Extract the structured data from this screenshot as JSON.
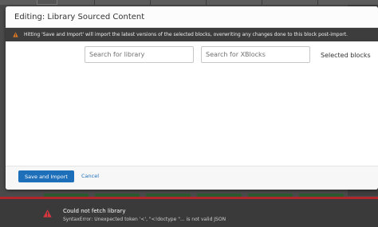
{
  "modal": {
    "title": "Editing: Library Sourced Content",
    "warning": "Hitting 'Save and Import' will import the latest versions of the selected blocks, overwriting any changes done to this block post-import.",
    "search_library_placeholder": "Search for library",
    "search_xblocks_placeholder": "Search for XBlocks",
    "selected_blocks_label": "Selected blocks",
    "save_label": "Save and Import",
    "cancel_label": "Cancel"
  },
  "notification": {
    "title": "Could not fetch library",
    "message": "SyntaxError: Unexpected token '<', \"<!doctype \"... is not valid JSON"
  },
  "colors": {
    "primary": "#1d6fba",
    "warning_bar": "#3d3d3d",
    "warning_icon": "#e07a1f",
    "error_accent": "#b1262a",
    "error_icon": "#d9363e"
  },
  "icons": {
    "warning": "warning-triangle-icon",
    "error": "error-triangle-icon"
  }
}
